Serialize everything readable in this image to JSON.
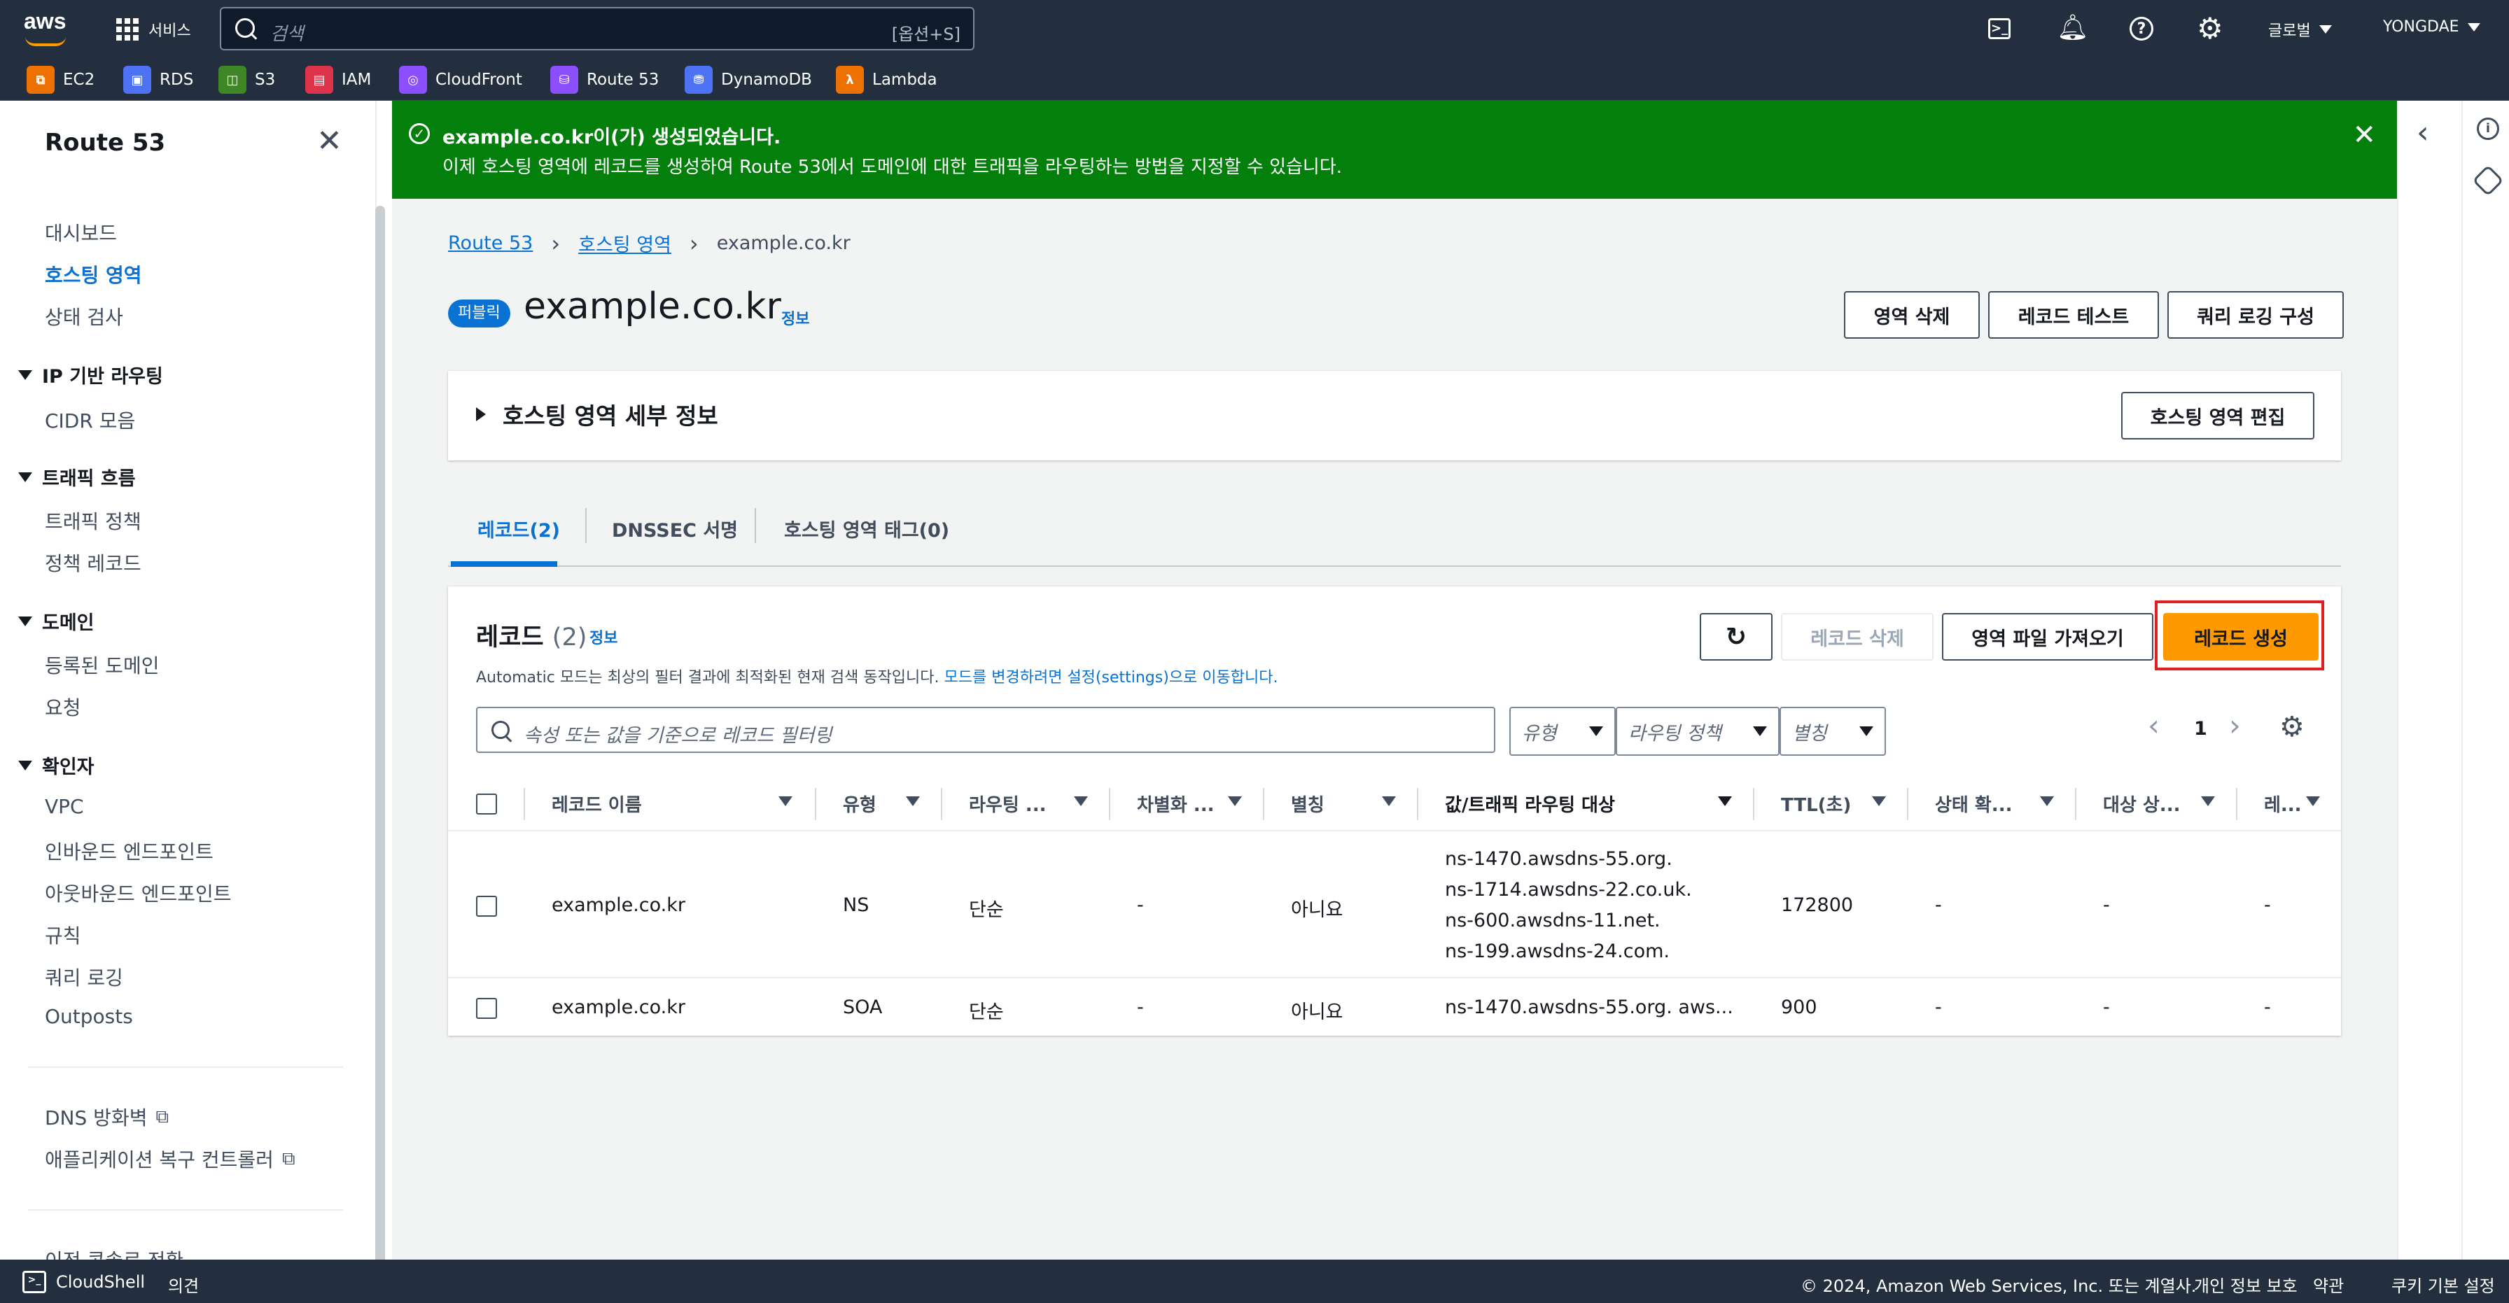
{
  "topnav": {
    "logo": "aws",
    "services_label": "서비스",
    "search_placeholder": "검색",
    "search_shortcut": "[옵션+S]",
    "region": "글로벌",
    "account": "YONGDAE"
  },
  "favorites": [
    {
      "label": "EC2",
      "color": "#ed7100",
      "glyph": "⧉"
    },
    {
      "label": "RDS",
      "color": "#4d72f3",
      "glyph": "▣"
    },
    {
      "label": "S3",
      "color": "#3f8624",
      "glyph": "◫"
    },
    {
      "label": "IAM",
      "color": "#dd344c",
      "glyph": "▤"
    },
    {
      "label": "CloudFront",
      "color": "#8c4fff",
      "glyph": "◎"
    },
    {
      "label": "Route 53",
      "color": "#8c4fff",
      "glyph": "⛁"
    },
    {
      "label": "DynamoDB",
      "color": "#4d72f3",
      "glyph": "⛃"
    },
    {
      "label": "Lambda",
      "color": "#ed7100",
      "glyph": "λ"
    }
  ],
  "sidebar": {
    "title": "Route 53",
    "items_top": [
      "대시보드",
      "호스팅 영역",
      "상태 검사"
    ],
    "sections": [
      {
        "title": "IP 기반 라우팅",
        "items": [
          "CIDR 모음"
        ]
      },
      {
        "title": "트래픽 흐름",
        "items": [
          "트래픽 정책",
          "정책 레코드"
        ]
      },
      {
        "title": "도메인",
        "items": [
          "등록된 도메인",
          "요청"
        ]
      },
      {
        "title": "확인자",
        "items": [
          "VPC",
          "인바운드 엔드포인트",
          "아웃바운드 엔드포인트",
          "규칙",
          "쿼리 로깅",
          "Outposts"
        ]
      }
    ],
    "links": [
      "DNS 방화벽",
      "애플리케이션 복구 컨트롤러"
    ],
    "bottom_partial": "이전 콘솔로 전환"
  },
  "flash": {
    "title": "example.co.kr이(가) 생성되었습니다.",
    "message": "이제 호스팅 영역에 레코드를 생성하여 Route 53에서 도메인에 대한 트래픽을 라우팅하는 방법을 지정할 수 있습니다."
  },
  "breadcrumb": {
    "items": [
      "Route 53",
      "호스팅 영역",
      "example.co.kr"
    ]
  },
  "header": {
    "badge": "퍼블릭",
    "title": "example.co.kr",
    "info": "정보",
    "buttons": [
      "영역 삭제",
      "레코드 테스트",
      "쿼리 로깅 구성"
    ]
  },
  "details": {
    "title": "호스팅 영역 세부 정보",
    "edit_button": "호스팅 영역 편집"
  },
  "tabs": [
    "레코드(2)",
    "DNSSEC 서명",
    "호스팅 영역 태그(0)"
  ],
  "records": {
    "title": "레코드",
    "count": "(2)",
    "info": "정보",
    "description": "Automatic 모드는 최상의 필터 결과에 최적화된 현재 검색 동작입니다.",
    "description_link": "모드를 변경하려면 설정(settings)으로 이동합니다.",
    "buttons": {
      "delete": "레코드 삭제",
      "import": "영역 파일 가져오기",
      "create": "레코드 생성"
    },
    "filter_placeholder": "속성 또는 값을 기준으로 레코드 필터링",
    "filters": [
      "유형",
      "라우팅 정책",
      "별칭"
    ],
    "page": "1",
    "columns": [
      "레코드 이름",
      "유형",
      "라우팅 ...",
      "차별화 ...",
      "별칭",
      "값/트래픽 라우팅 대상",
      "TTL(초)",
      "상태 확...",
      "대상 상...",
      "레..."
    ],
    "rows": [
      {
        "name": "example.co.kr",
        "type": "NS",
        "routing": "단순",
        "diff": "-",
        "alias": "아니요",
        "values": [
          "ns-1470.awsdns-55.org.",
          "ns-1714.awsdns-22.co.uk.",
          "ns-600.awsdns-11.net.",
          "ns-199.awsdns-24.com."
        ],
        "ttl": "172800",
        "health": "-",
        "target": "-",
        "rec": "-"
      },
      {
        "name": "example.co.kr",
        "type": "SOA",
        "routing": "단순",
        "diff": "-",
        "alias": "아니요",
        "values": [
          "ns-1470.awsdns-55.org. aws..."
        ],
        "ttl": "900",
        "health": "-",
        "target": "-",
        "rec": "-"
      }
    ]
  },
  "footer": {
    "cloudshell": "CloudShell",
    "feedback": "의견",
    "copyright": "© 2024, Amazon Web Services, Inc. 또는 계열사.",
    "privacy": "개인 정보 보호",
    "terms": "약관",
    "cookies": "쿠키 기본 설정"
  },
  "colors": {
    "nav": "#232f3e",
    "success": "#037f0c",
    "link": "#0972d3",
    "primary": "#ff9900",
    "highlight": "#e02020"
  }
}
